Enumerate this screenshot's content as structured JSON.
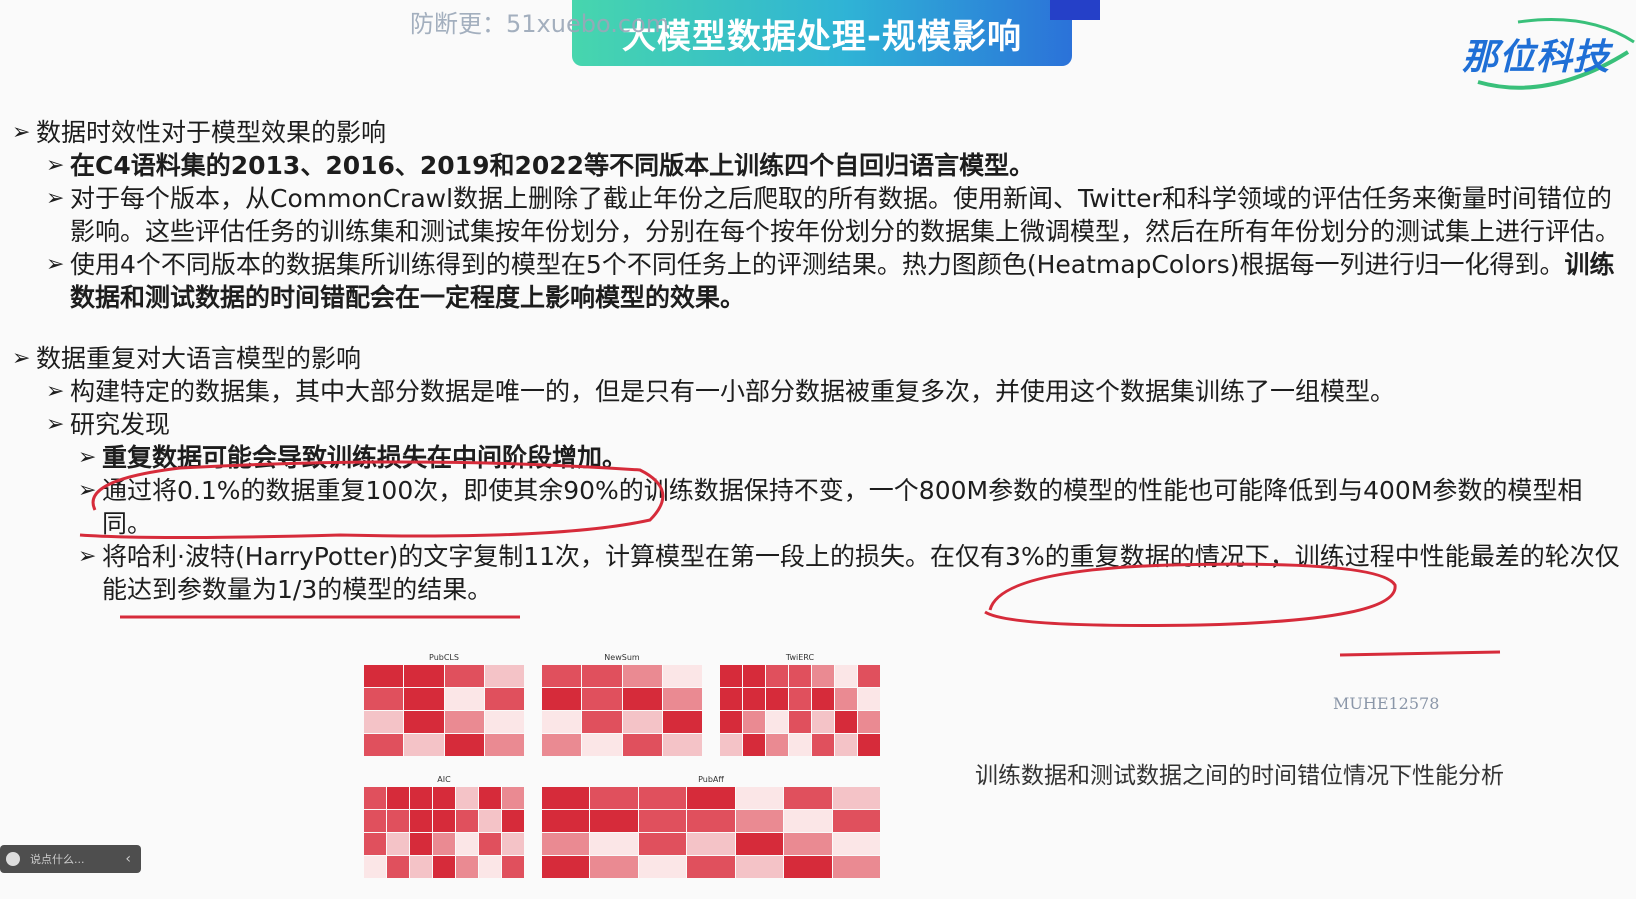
{
  "watermark": "防断更：51xuebo.com",
  "header": {
    "title": "大模型数据处理-规模影响",
    "logo": "那位科技"
  },
  "section1": {
    "heading": "数据时效性对于模型效果的影响",
    "b1": "在C4语料集的2013、2016、2019和2022等不同版本上训练四个自回归语言模型。",
    "b2": "对于每个版本，从CommonCrawl数据上删除了截止年份之后爬取的所有数据。使用新闻、Twitter和科学领域的评估任务来衡量时间错位的影响。这些评估任务的训练集和测试集按年份划分，分别在每个按年份划分的数据集上微调模型，然后在所有年份划分的测试集上进行评估。",
    "b3a": "使用4个不同版本的数据集所训练得到的模型在5个不同任务上的评测结果。热力图颜色(HeatmapColors)根据每一列进行归一化得到。",
    "b3b": "训练数据和测试数据的时间错配会在一定程度上影响模型的效果。"
  },
  "section2": {
    "heading": "数据重复对大语言模型的影响",
    "b1": "构建特定的数据集，其中大部分数据是唯一的，但是只有一小部分数据被重复多次，并使用这个数据集训练了一组模型。",
    "b2": "研究发现",
    "s1": "重复数据可能会导致训练损失在中间阶段增加。",
    "s2": "通过将0.1%的数据重复100次，即使其余90%的训练数据保持不变，一个800M参数的模型的性能也可能降低到与400M参数的模型相同。",
    "s3": "将哈利·波特(HarryPotter)的文字复制11次，计算模型在第一段上的损失。在仅有3%的重复数据的情况下，训练过程中性能最差的轮次仅能达到参数量为1/3的模型的结果。"
  },
  "figure": {
    "panels": [
      {
        "title": "PubCLS",
        "cols": 4
      },
      {
        "title": "NewSum",
        "cols": 4
      },
      {
        "title": "TwiERC",
        "cols": 7
      },
      {
        "title": "AIC",
        "cols": 7
      },
      {
        "title": "PubAff",
        "cols": 7
      }
    ],
    "caption": "训练数据和测试数据之间的时间错位情况下性能分析",
    "id_mark": "MUHE12578"
  },
  "widget": {
    "placeholder": "说点什么..."
  },
  "colors": {
    "accent": "#d62b3a",
    "title_from": "#47d6ad",
    "title_to": "#2b72d9",
    "logo": "#1f6fd6"
  }
}
